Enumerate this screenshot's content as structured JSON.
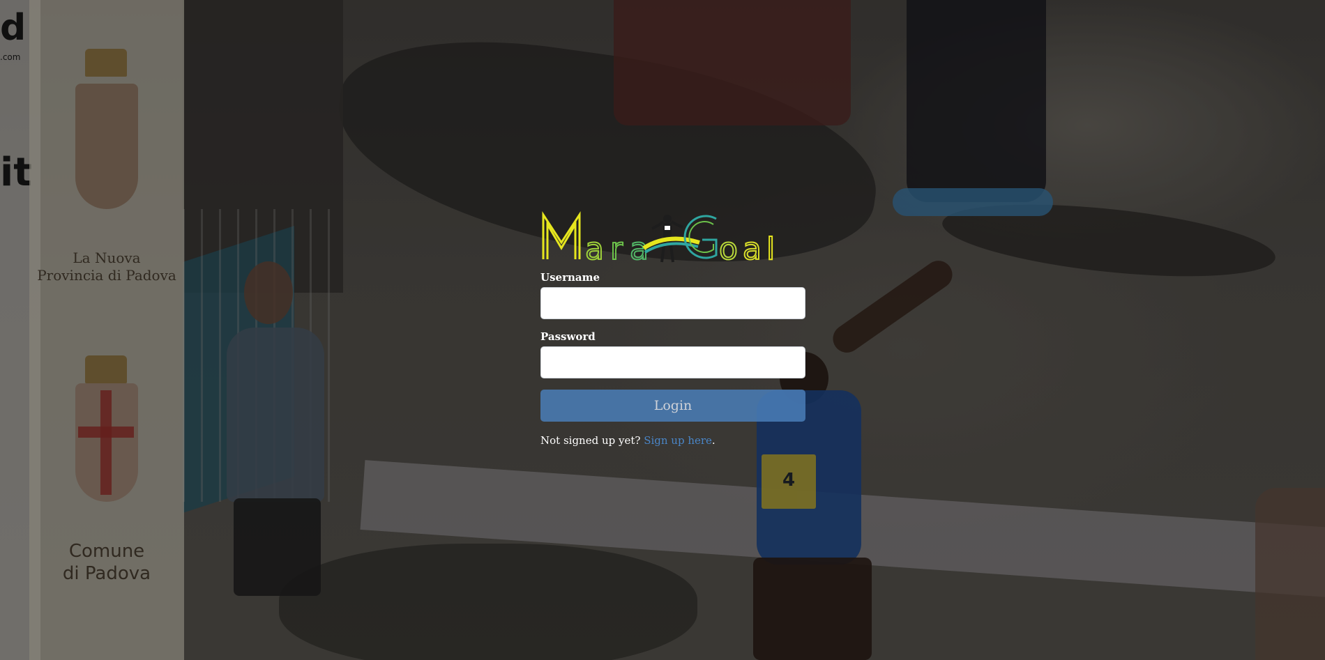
{
  "app": {
    "title": "MaratGoal"
  },
  "background": {
    "banner_text_top_line1": "La Nuova",
    "banner_text_top_line2": "Provincia di Padova",
    "banner_text_bottom_line1": "Comune",
    "banner_text_bottom_line2": "di Padova",
    "edge_text_1": "d",
    "edge_text_2": ".com",
    "edge_text_3": "it",
    "bib_number": "4"
  },
  "logo": {
    "letters": [
      "M",
      "a",
      "r",
      "a",
      "G",
      "o",
      "a",
      "l"
    ],
    "colors": {
      "yellow": "#e6e61e",
      "green": "#6cc24a",
      "teal": "#2fa6a0"
    }
  },
  "form": {
    "username_label": "Username",
    "username_value": "",
    "password_label": "Password",
    "password_value": "",
    "login_label": "Login",
    "signup_prefix": "Not signed up yet?",
    "signup_link": "Sign up here",
    "signup_suffix": "."
  },
  "colors": {
    "button": "#4a7eb8",
    "link": "#4a86c8"
  }
}
